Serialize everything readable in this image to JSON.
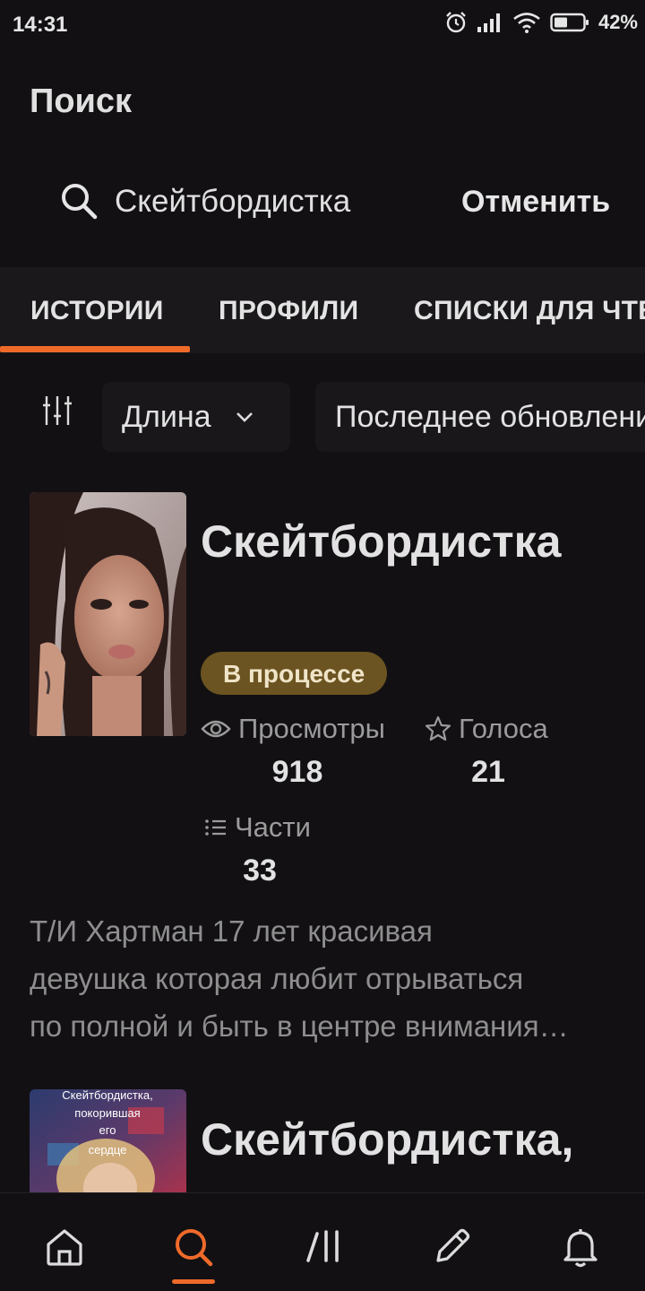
{
  "status_bar": {
    "time": "14:31",
    "battery": "42%",
    "icons": [
      "alarm-icon",
      "signal-icon",
      "wifi-icon",
      "battery-icon"
    ]
  },
  "header": {
    "title": "Поиск"
  },
  "search": {
    "value": "Скейтбордистка",
    "cancel_label": "Отменить"
  },
  "tabs": [
    {
      "label": "ИСТОРИИ",
      "active": true
    },
    {
      "label": "ПРОФИЛИ",
      "active": false
    },
    {
      "label": "СПИСКИ ДЛЯ ЧТЕНИЯ",
      "active": false
    }
  ],
  "filters": {
    "length_label": "Длина",
    "updated_label": "Последнее обновление"
  },
  "stories": [
    {
      "title": "Скейтбордистка",
      "status": "В процессе",
      "views_label": "Просмотры",
      "views": "918",
      "votes_label": "Голоса",
      "votes": "21",
      "parts_label": "Части",
      "parts": "33",
      "description_lines": [
        "Т/И Хартман 17 лет красивая",
        "девушка которая любит отрываться",
        "по полной и быть в центре внимания…"
      ]
    },
    {
      "title": "Скейтбордистка,",
      "cover_text": [
        "Скейтбордистка,",
        "покорившая",
        "его",
        "сердце"
      ]
    }
  ],
  "colors": {
    "accent": "#ef6a2a",
    "background": "#121013",
    "badge": "#6b5421"
  },
  "bottom_nav": [
    "home-icon",
    "search-icon",
    "library-icon",
    "write-icon",
    "notifications-icon"
  ]
}
